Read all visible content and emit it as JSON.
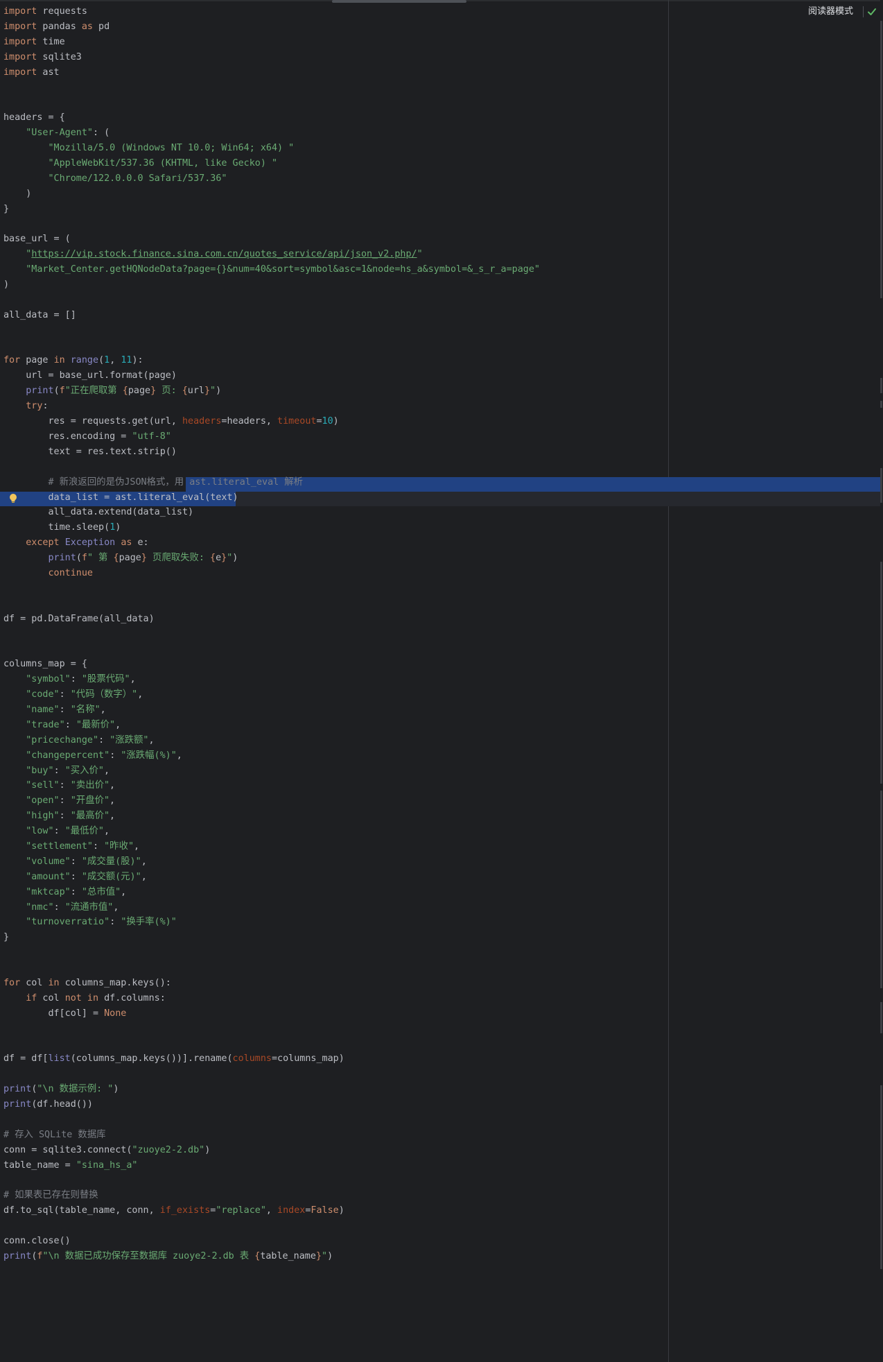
{
  "toolbar": {
    "reader_mode_label": "阅读器模式",
    "inspection_status_icon": "check-icon",
    "intention_icon": "lightbulb-icon"
  },
  "colors": {
    "background": "#1e1f22",
    "keyword": "#cf8e6d",
    "string": "#6aab73",
    "number": "#2aacb8",
    "builtin": "#8888c6",
    "comment": "#7a7e85",
    "parameter": "#aa4926",
    "selection": "#214283",
    "default_text": "#bcbec4"
  },
  "code": {
    "lines": [
      [
        [
          "kw",
          "import"
        ],
        [
          "t",
          " requests"
        ]
      ],
      [
        [
          "kw",
          "import"
        ],
        [
          "t",
          " pandas "
        ],
        [
          "kw",
          "as"
        ],
        [
          "t",
          " pd"
        ]
      ],
      [
        [
          "kw",
          "import"
        ],
        [
          "t",
          " time"
        ]
      ],
      [
        [
          "kw",
          "import"
        ],
        [
          "t",
          " sqlite3"
        ]
      ],
      [
        [
          "kw",
          "import"
        ],
        [
          "t",
          " ast"
        ]
      ],
      [],
      [],
      [
        [
          "t",
          "headers = {"
        ]
      ],
      [
        [
          "t",
          "    "
        ],
        [
          "str",
          "\"User-Agent\""
        ],
        [
          "t",
          ": ("
        ]
      ],
      [
        [
          "t",
          "        "
        ],
        [
          "str",
          "\"Mozilla/5.0 (Windows NT 10.0; Win64; x64) \""
        ]
      ],
      [
        [
          "t",
          "        "
        ],
        [
          "str",
          "\"AppleWebKit/537.36 (KHTML, like Gecko) \""
        ]
      ],
      [
        [
          "t",
          "        "
        ],
        [
          "str",
          "\"Chrome/122.0.0.0 Safari/537.36\""
        ]
      ],
      [
        [
          "t",
          "    )"
        ]
      ],
      [
        [
          "t",
          "}"
        ]
      ],
      [],
      [
        [
          "t",
          "base_url = ("
        ]
      ],
      [
        [
          "t",
          "    "
        ],
        [
          "str",
          "\""
        ],
        [
          "url",
          "https://vip.stock.finance.sina.com.cn/quotes_service/api/json_v2.php/"
        ],
        [
          "str",
          "\""
        ]
      ],
      [
        [
          "t",
          "    "
        ],
        [
          "str",
          "\"Market_Center.getHQNodeData?page={}&num=40&sort=symbol&asc=1&node=hs_a&symbol=&_s_r_a=page\""
        ]
      ],
      [
        [
          "t",
          ")"
        ]
      ],
      [],
      [
        [
          "t",
          "all_data = []"
        ]
      ],
      [],
      [],
      [
        [
          "kw",
          "for"
        ],
        [
          "t",
          " page "
        ],
        [
          "kw",
          "in"
        ],
        [
          "t",
          " "
        ],
        [
          "bi",
          "range"
        ],
        [
          "t",
          "("
        ],
        [
          "num",
          "1"
        ],
        [
          "t",
          ", "
        ],
        [
          "num",
          "11"
        ],
        [
          "t",
          "):"
        ]
      ],
      [
        [
          "t",
          "    url = base_url.format(page)"
        ]
      ],
      [
        [
          "t",
          "    "
        ],
        [
          "bi",
          "print"
        ],
        [
          "t",
          "("
        ],
        [
          "kw",
          "f"
        ],
        [
          "str",
          "\"正在爬取第 "
        ],
        [
          "kw",
          "{"
        ],
        [
          "t",
          "page"
        ],
        [
          "kw",
          "}"
        ],
        [
          "str",
          " 页: "
        ],
        [
          "kw",
          "{"
        ],
        [
          "t",
          "url"
        ],
        [
          "kw",
          "}"
        ],
        [
          "str",
          "\""
        ],
        [
          "t",
          ")"
        ]
      ],
      [
        [
          "t",
          "    "
        ],
        [
          "kw",
          "try"
        ],
        [
          "t",
          ":"
        ]
      ],
      [
        [
          "t",
          "        res = requests.get(url, "
        ],
        [
          "par",
          "headers"
        ],
        [
          "t",
          "=headers, "
        ],
        [
          "par",
          "timeout"
        ],
        [
          "t",
          "="
        ],
        [
          "num",
          "10"
        ],
        [
          "t",
          ")"
        ]
      ],
      [
        [
          "t",
          "        res.encoding = "
        ],
        [
          "str",
          "\"utf-8\""
        ]
      ],
      [
        [
          "t",
          "        text = res.text.strip()"
        ]
      ],
      [],
      [
        [
          "t",
          "        "
        ],
        [
          "cm",
          "# 新浪返回的是伪JSON格式，用 ast.literal_eval 解析"
        ]
      ],
      [
        [
          "t",
          "        data_list = ast.literal_eval(text)"
        ]
      ],
      [
        [
          "t",
          "        all_data.extend(data_list)"
        ]
      ],
      [
        [
          "t",
          "        time.sleep("
        ],
        [
          "num",
          "1"
        ],
        [
          "t",
          ")"
        ]
      ],
      [
        [
          "t",
          "    "
        ],
        [
          "kw",
          "except"
        ],
        [
          "t",
          " "
        ],
        [
          "bi",
          "Exception"
        ],
        [
          "t",
          " "
        ],
        [
          "kw",
          "as"
        ],
        [
          "t",
          " e:"
        ]
      ],
      [
        [
          "t",
          "        "
        ],
        [
          "bi",
          "print"
        ],
        [
          "t",
          "("
        ],
        [
          "kw",
          "f"
        ],
        [
          "str",
          "\" 第 "
        ],
        [
          "kw",
          "{"
        ],
        [
          "t",
          "page"
        ],
        [
          "kw",
          "}"
        ],
        [
          "str",
          " 页爬取失败: "
        ],
        [
          "kw",
          "{"
        ],
        [
          "t",
          "e"
        ],
        [
          "kw",
          "}"
        ],
        [
          "str",
          "\""
        ],
        [
          "t",
          ")"
        ]
      ],
      [
        [
          "t",
          "        "
        ],
        [
          "kw",
          "continue"
        ]
      ],
      [],
      [],
      [
        [
          "t",
          "df = pd.DataFrame(all_data)"
        ]
      ],
      [],
      [],
      [
        [
          "t",
          "columns_map = {"
        ]
      ],
      [
        [
          "t",
          "    "
        ],
        [
          "str",
          "\"symbol\""
        ],
        [
          "t",
          ": "
        ],
        [
          "str",
          "\"股票代码\""
        ],
        [
          "t",
          ","
        ]
      ],
      [
        [
          "t",
          "    "
        ],
        [
          "str",
          "\"code\""
        ],
        [
          "t",
          ": "
        ],
        [
          "str",
          "\"代码（数字）\""
        ],
        [
          "t",
          ","
        ]
      ],
      [
        [
          "t",
          "    "
        ],
        [
          "str",
          "\"name\""
        ],
        [
          "t",
          ": "
        ],
        [
          "str",
          "\"名称\""
        ],
        [
          "t",
          ","
        ]
      ],
      [
        [
          "t",
          "    "
        ],
        [
          "str",
          "\"trade\""
        ],
        [
          "t",
          ": "
        ],
        [
          "str",
          "\"最新价\""
        ],
        [
          "t",
          ","
        ]
      ],
      [
        [
          "t",
          "    "
        ],
        [
          "str",
          "\"pricechange\""
        ],
        [
          "t",
          ": "
        ],
        [
          "str",
          "\"涨跌额\""
        ],
        [
          "t",
          ","
        ]
      ],
      [
        [
          "t",
          "    "
        ],
        [
          "str",
          "\"changepercent\""
        ],
        [
          "t",
          ": "
        ],
        [
          "str",
          "\"涨跌幅(%)\""
        ],
        [
          "t",
          ","
        ]
      ],
      [
        [
          "t",
          "    "
        ],
        [
          "str",
          "\"buy\""
        ],
        [
          "t",
          ": "
        ],
        [
          "str",
          "\"买入价\""
        ],
        [
          "t",
          ","
        ]
      ],
      [
        [
          "t",
          "    "
        ],
        [
          "str",
          "\"sell\""
        ],
        [
          "t",
          ": "
        ],
        [
          "str",
          "\"卖出价\""
        ],
        [
          "t",
          ","
        ]
      ],
      [
        [
          "t",
          "    "
        ],
        [
          "str",
          "\"open\""
        ],
        [
          "t",
          ": "
        ],
        [
          "str",
          "\"开盘价\""
        ],
        [
          "t",
          ","
        ]
      ],
      [
        [
          "t",
          "    "
        ],
        [
          "str",
          "\"high\""
        ],
        [
          "t",
          ": "
        ],
        [
          "str",
          "\"最高价\""
        ],
        [
          "t",
          ","
        ]
      ],
      [
        [
          "t",
          "    "
        ],
        [
          "str",
          "\"low\""
        ],
        [
          "t",
          ": "
        ],
        [
          "str",
          "\"最低价\""
        ],
        [
          "t",
          ","
        ]
      ],
      [
        [
          "t",
          "    "
        ],
        [
          "str",
          "\"settlement\""
        ],
        [
          "t",
          ": "
        ],
        [
          "str",
          "\"昨收\""
        ],
        [
          "t",
          ","
        ]
      ],
      [
        [
          "t",
          "    "
        ],
        [
          "str",
          "\"volume\""
        ],
        [
          "t",
          ": "
        ],
        [
          "str",
          "\"成交量(股)\""
        ],
        [
          "t",
          ","
        ]
      ],
      [
        [
          "t",
          "    "
        ],
        [
          "str",
          "\"amount\""
        ],
        [
          "t",
          ": "
        ],
        [
          "str",
          "\"成交额(元)\""
        ],
        [
          "t",
          ","
        ]
      ],
      [
        [
          "t",
          "    "
        ],
        [
          "str",
          "\"mktcap\""
        ],
        [
          "t",
          ": "
        ],
        [
          "str",
          "\"总市值\""
        ],
        [
          "t",
          ","
        ]
      ],
      [
        [
          "t",
          "    "
        ],
        [
          "str",
          "\"nmc\""
        ],
        [
          "t",
          ": "
        ],
        [
          "str",
          "\"流通市值\""
        ],
        [
          "t",
          ","
        ]
      ],
      [
        [
          "t",
          "    "
        ],
        [
          "str",
          "\"turnoverratio\""
        ],
        [
          "t",
          ": "
        ],
        [
          "str",
          "\"换手率(%)\""
        ]
      ],
      [
        [
          "t",
          "}"
        ]
      ],
      [],
      [],
      [
        [
          "kw",
          "for"
        ],
        [
          "t",
          " col "
        ],
        [
          "kw",
          "in"
        ],
        [
          "t",
          " columns_map.keys():"
        ]
      ],
      [
        [
          "t",
          "    "
        ],
        [
          "kw",
          "if"
        ],
        [
          "t",
          " col "
        ],
        [
          "kw",
          "not in"
        ],
        [
          "t",
          " df.columns:"
        ]
      ],
      [
        [
          "t",
          "        df[col] = "
        ],
        [
          "kw",
          "None"
        ]
      ],
      [],
      [],
      [
        [
          "t",
          "df = df["
        ],
        [
          "bi",
          "list"
        ],
        [
          "t",
          "(columns_map.keys())].rename("
        ],
        [
          "par",
          "columns"
        ],
        [
          "t",
          "=columns_map)"
        ]
      ],
      [],
      [
        [
          "bi",
          "print"
        ],
        [
          "t",
          "("
        ],
        [
          "str",
          "\"\\n 数据示例: \""
        ],
        [
          "t",
          ")"
        ]
      ],
      [
        [
          "bi",
          "print"
        ],
        [
          "t",
          "(df.head())"
        ]
      ],
      [],
      [
        [
          "cm",
          "# 存入 SQLite 数据库"
        ]
      ],
      [
        [
          "t",
          "conn = sqlite3.connect("
        ],
        [
          "str",
          "\"zuoye2-2.db\""
        ],
        [
          "t",
          ")"
        ]
      ],
      [
        [
          "t",
          "table_name = "
        ],
        [
          "str",
          "\"sina_hs_a\""
        ]
      ],
      [],
      [
        [
          "cm",
          "# 如果表已存在则替换"
        ]
      ],
      [
        [
          "t",
          "df.to_sql(table_name, conn, "
        ],
        [
          "par",
          "if_exists"
        ],
        [
          "t",
          "="
        ],
        [
          "str",
          "\"replace\""
        ],
        [
          "t",
          ", "
        ],
        [
          "par",
          "index"
        ],
        [
          "t",
          "="
        ],
        [
          "kw",
          "False"
        ],
        [
          "t",
          ")"
        ]
      ],
      [],
      [
        [
          "t",
          "conn.close()"
        ]
      ],
      [
        [
          "bi",
          "print"
        ],
        [
          "t",
          "("
        ],
        [
          "kw",
          "f"
        ],
        [
          "str",
          "\"\\n 数据已成功保存至数据库 zuoye2-2.db 表 "
        ],
        [
          "kw",
          "{"
        ],
        [
          "t",
          "table_name"
        ],
        [
          "kw",
          "}"
        ],
        [
          "str",
          "\""
        ],
        [
          "t",
          ")"
        ]
      ]
    ]
  }
}
